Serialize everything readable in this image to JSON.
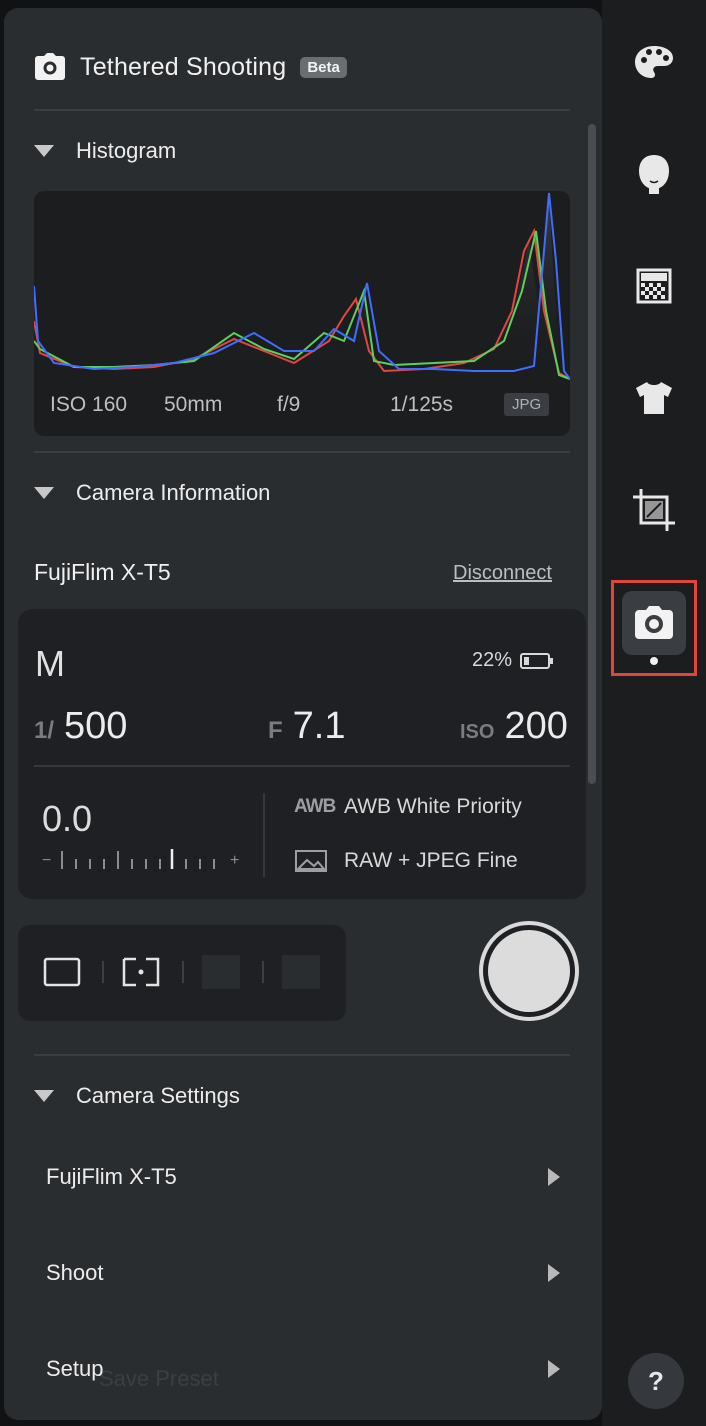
{
  "header": {
    "title": "Tethered Shooting",
    "badge": "Beta",
    "icon": "camera-icon"
  },
  "histogram_section": {
    "title": "Histogram",
    "iso": "ISO 160",
    "focal_length": "50mm",
    "aperture": "f/9",
    "shutter": "1/125s",
    "format_badge": "JPG",
    "colors": {
      "red": "#e2463f",
      "green": "#5ccf5c",
      "blue": "#3f6dff"
    }
  },
  "camera_info": {
    "title": "Camera Information",
    "camera_name": "FujiFlim X-T5",
    "disconnect_label": "Disconnect",
    "mode": "M",
    "battery": "22%",
    "shutter_label": "1/",
    "shutter_value": "500",
    "aperture_label": "F",
    "aperture_value": "7.1",
    "iso_label": "ISO",
    "iso_value": "200",
    "exposure_comp": "0.0",
    "ev_minus": "−",
    "ev_plus": "+",
    "white_balance_icon": "AWB",
    "white_balance": "AWB White Priority",
    "image_quality": "RAW + JPEG Fine",
    "image_quality_icon": "image-icon"
  },
  "shoot_modes": [
    "single-frame-icon",
    "focus-point-icon",
    "mode-3-icon",
    "mode-4-icon"
  ],
  "camera_settings": {
    "title": "Camera Settings",
    "items": [
      {
        "label": "FujiFlim X-T5"
      },
      {
        "label": "Shoot"
      },
      {
        "label": "Setup"
      }
    ],
    "faded_text": "Save Preset"
  },
  "right_rail": {
    "icons": [
      "palette-icon",
      "face-icon",
      "pattern-icon",
      "shirt-icon",
      "crop-icon",
      "camera-icon"
    ],
    "active": "camera-icon",
    "active_color": "#e0463a",
    "help_label": "?"
  }
}
